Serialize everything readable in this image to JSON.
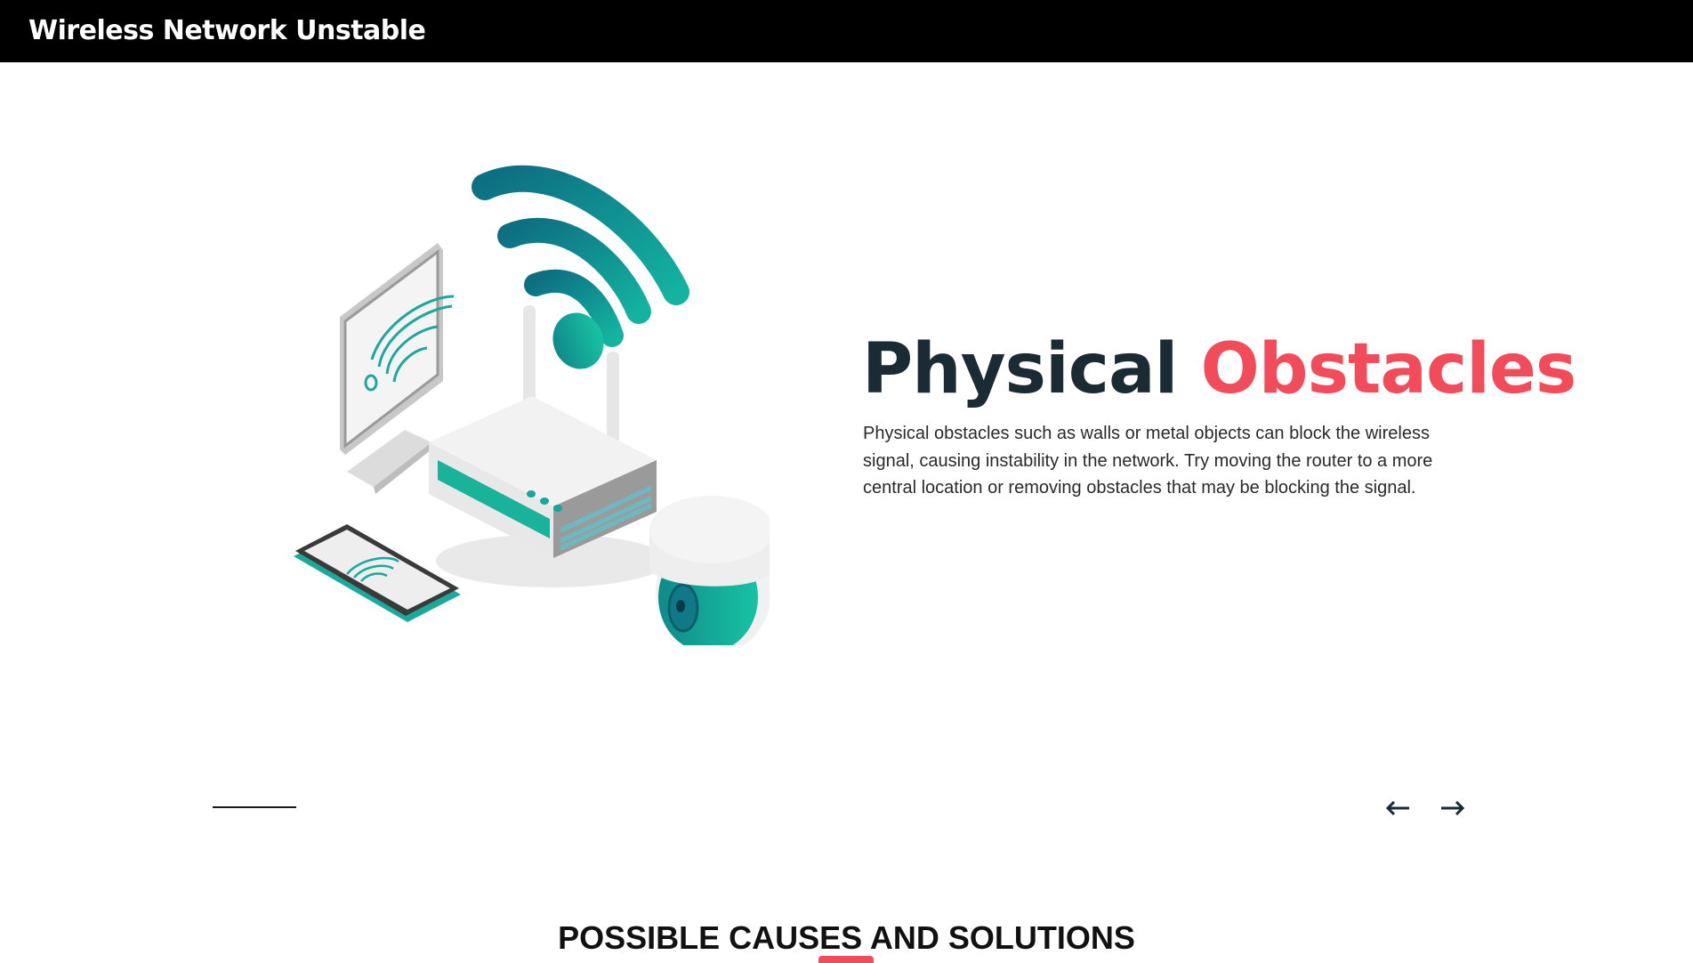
{
  "header": {
    "title": "Wireless Network Unstable"
  },
  "slide": {
    "illustration": "router-wifi-devices-illustration",
    "title_part1": "Physical",
    "title_part2": "Obstacles",
    "body": "Physical obstacles such as walls or metal objects can block the wireless signal, causing instability in the network. Try moving the router to a more central location or removing obstacles that may be blocking the signal.",
    "prev_icon": "arrow-left-icon",
    "next_icon": "arrow-right-icon"
  },
  "section": {
    "heading": "POSSIBLE CAUSES AND SOLUTIONS"
  },
  "colors": {
    "accent": "#f24c5a",
    "heading_dark": "#1a2b33",
    "teal": "#13a89e",
    "teal_dark": "#0f7a86",
    "header_bg": "#000000"
  }
}
